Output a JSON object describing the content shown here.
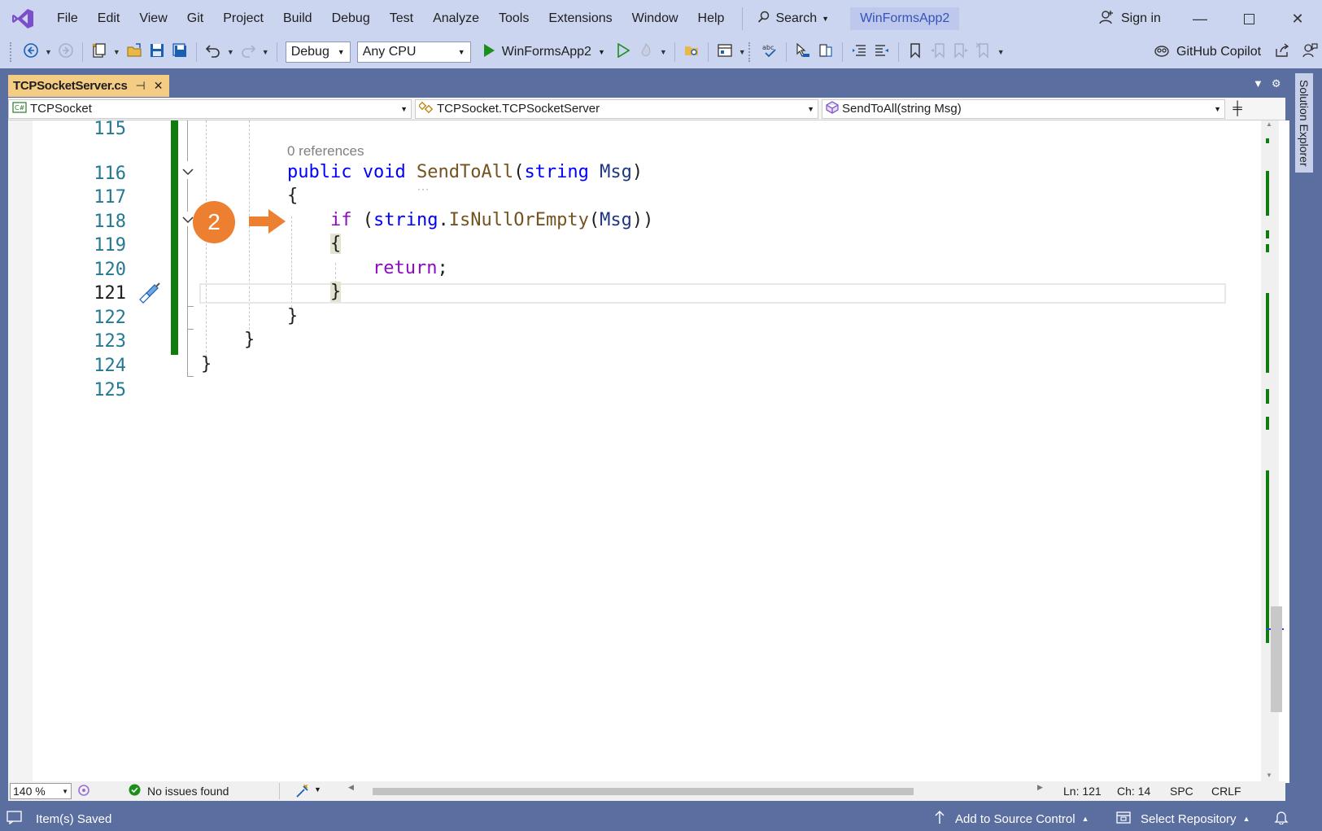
{
  "menu": {
    "items": [
      "File",
      "Edit",
      "View",
      "Git",
      "Project",
      "Build",
      "Debug",
      "Test",
      "Analyze",
      "Tools",
      "Extensions",
      "Window",
      "Help"
    ],
    "search_label": "Search",
    "solution_name": "WinFormsApp2",
    "sign_in": "Sign in"
  },
  "toolbar": {
    "config": "Debug",
    "platform": "Any CPU",
    "run_target": "WinFormsApp2",
    "copilot": "GitHub Copilot"
  },
  "document": {
    "tab_title": "TCPSocketServer.cs",
    "nav_project": "TCPSocket",
    "nav_class": "TCPSocket.TCPSocketServer",
    "nav_member": "SendToAll(string Msg)"
  },
  "editor": {
    "code_lens": "0 references",
    "annotation_number": "2",
    "line_numbers": [
      "115",
      "116",
      "117",
      "118",
      "119",
      "120",
      "121",
      "122",
      "123",
      "124",
      "125"
    ],
    "lines": {
      "l116": {
        "kw1": "public",
        "kw2": "void",
        "method": "SendToAll",
        "p1": "(",
        "type": "string",
        "param": "Msg",
        "p2": ")"
      },
      "l117": "{",
      "l118": {
        "kw": "if",
        "p1": "(",
        "type": "string",
        "dot": ".",
        "method": "IsNullOrEmpty",
        "p2": "(",
        "param": "Msg",
        "p3": "))"
      },
      "l119": "{",
      "l120": {
        "kw": "return",
        "semi": ";"
      },
      "l121": "}",
      "l122": "}",
      "l123": "}",
      "l124": "}"
    }
  },
  "editor_status": {
    "zoom": "140 %",
    "issues": "No issues found",
    "line": "Ln: 121",
    "col": "Ch: 14",
    "whitespace": "SPC",
    "line_ending": "CRLF"
  },
  "side_panel": {
    "solution_explorer": "Solution Explorer"
  },
  "statusbar": {
    "message": "Item(s) Saved",
    "source_control": "Add to Source Control",
    "repository": "Select Repository"
  },
  "colors": {
    "accent": "#ccd5f0",
    "well": "#5a6ea0",
    "change_bar": "#107c10",
    "badge": "#ec7f30",
    "tab_active": "#f5cc84"
  }
}
